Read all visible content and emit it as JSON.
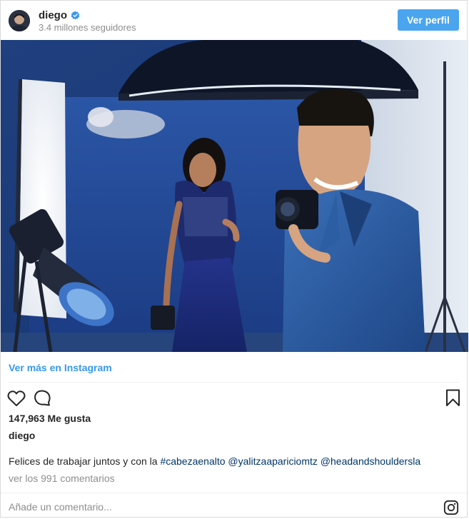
{
  "header": {
    "username": "diego",
    "verified": true,
    "followers": "3.4 millones seguidores",
    "profile_button": "Ver perfil"
  },
  "photo": {
    "blurred_sign": "blurred-logo-sign"
  },
  "more_link": "Ver más en Instagram",
  "actions": {
    "like_icon": "heart-icon",
    "comment_icon": "comment-icon",
    "save_icon": "bookmark-icon"
  },
  "likes": "147,963 Me gusta",
  "post_username": "diego",
  "caption": {
    "text": "Felices de trabajar juntos y con la ",
    "hashtag": "#cabezaenalto",
    "mention1": "@yalitzaapariciomtz",
    "mention2": "@headandshouldersla"
  },
  "comments_link": "ver los 991 comentarios",
  "comment_box": {
    "placeholder": "Añade un comentario...",
    "value": ""
  },
  "colors": {
    "accent": "#4aa5ee",
    "link": "#3897f0",
    "tag": "#003569",
    "muted": "#8e8e8e",
    "border": "#dbdbdb"
  }
}
